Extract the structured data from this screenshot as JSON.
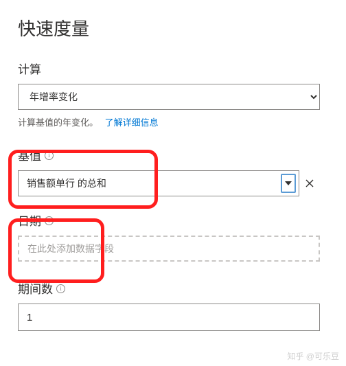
{
  "title": "快速度量",
  "sections": {
    "calc": {
      "label": "计算",
      "value": "年增率变化",
      "description": "计算基值的年变化。",
      "learn_more": "了解详细信息"
    },
    "base": {
      "label": "基值",
      "value": "销售额单行 的总和",
      "clear_label": "×"
    },
    "date": {
      "label": "日期",
      "placeholder": "在此处添加数据字段"
    },
    "periods": {
      "label": "期间数",
      "value": "1"
    }
  },
  "watermark": "知乎 @可乐豆"
}
